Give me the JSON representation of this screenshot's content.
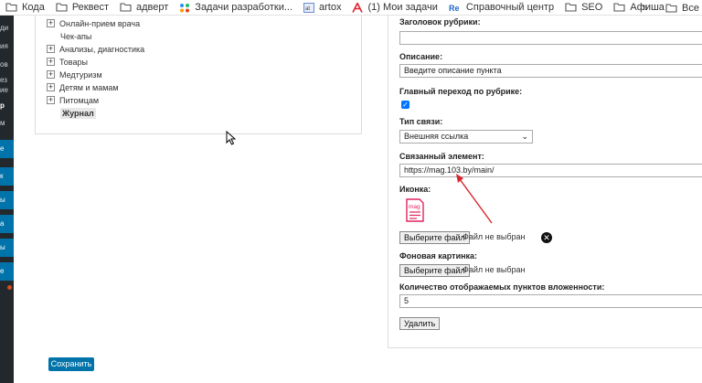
{
  "bookmarks": [
    {
      "label": "Кода",
      "icon": "folder-icon"
    },
    {
      "label": "Реквест",
      "icon": "folder-icon"
    },
    {
      "label": "адверт",
      "icon": "folder-icon"
    },
    {
      "label": "Задачи разработки...",
      "icon": "task-icon"
    },
    {
      "label": "artox",
      "icon": "site-icon"
    },
    {
      "label": "(1) Мои задачи",
      "icon": "a-logo-icon"
    },
    {
      "label": "Справочный центр",
      "icon": "re-logo-icon"
    },
    {
      "label": "SEO",
      "icon": "folder-icon"
    },
    {
      "label": "Афиша",
      "icon": "folder-icon"
    }
  ],
  "bookmarks_overflow": "»",
  "bookmarks_all": "Все",
  "sidebar": {
    "items": [
      "ди",
      "ия",
      "ов",
      "ез",
      "ие",
      "р",
      "м",
      "е",
      "к",
      "ы",
      "а",
      "ы",
      "е"
    ]
  },
  "tree": {
    "items": [
      {
        "label": "Онлайн-прием врача",
        "expandable": true
      },
      {
        "label": "Чек-апы",
        "expandable": false
      },
      {
        "label": "Анализы, диагностика",
        "expandable": true
      },
      {
        "label": "Товары",
        "expandable": true
      },
      {
        "label": "Медтуризм",
        "expandable": true
      },
      {
        "label": "Детям и мамам",
        "expandable": true
      },
      {
        "label": "Питомцам",
        "expandable": true
      },
      {
        "label": "Журнал",
        "expandable": false,
        "selected": true
      }
    ]
  },
  "form": {
    "heading_label": "Заголовок рубрики:",
    "heading_value": "",
    "description_label": "Описание:",
    "description_value": "Введите описание пункта",
    "main_link_label": "Главный переход по рубрике:",
    "main_link_checked": true,
    "link_type_label": "Тип связи:",
    "link_type_value": "Внешняя ссылка",
    "linked_element_label": "Связанный элемент:",
    "linked_element_value": "https://mag.103.by/main/",
    "icon_label": "Иконка:",
    "icon_text": "mag",
    "choose_file_label": "Выберите файл",
    "no_file_label": "Файл не выбран",
    "bg_image_label": "Фоновая картинка:",
    "bg_choose_file_label": "Выберите файл",
    "bg_no_file_label": "Файл не выбран",
    "nesting_label": "Количество отображаемых пунктов вложенности:",
    "nesting_value": "5",
    "delete_label": "Удалить"
  },
  "save_label": "Сохранить",
  "colors": {
    "accent": "#0073aa",
    "sidebar_bg": "#23282d",
    "arrow": "#d9262c",
    "icon_pink": "#e0245e"
  }
}
